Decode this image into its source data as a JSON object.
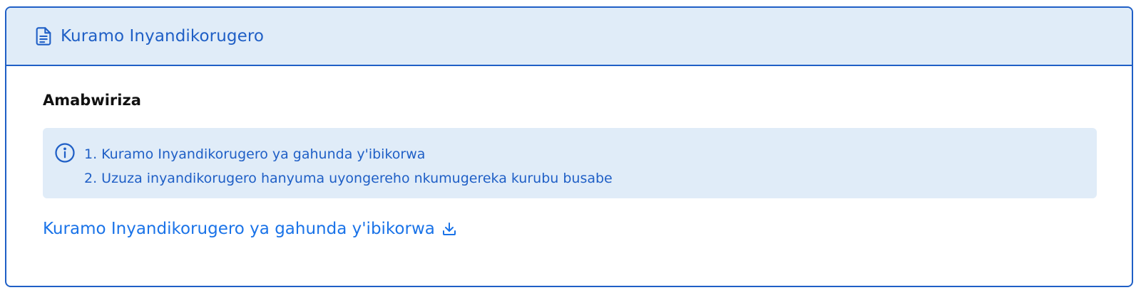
{
  "card": {
    "header": {
      "title": "Kuramo Inyandikorugero",
      "icon": "document-icon"
    },
    "section_title": "Amabwiriza",
    "info": {
      "icon": "info-icon",
      "items": [
        "1. Kuramo Inyandikorugero ya gahunda y'ibikorwa",
        "2. Uzuza inyandikorugero hanyuma uyongereho nkumugereka kurubu busabe"
      ]
    },
    "download": {
      "label": "Kuramo Inyandikorugero ya gahunda y'ibikorwa",
      "icon": "download-icon"
    }
  },
  "colors": {
    "accent": "#1f5fc6",
    "header_bg": "#e0ecf8",
    "link": "#1a73e8"
  }
}
